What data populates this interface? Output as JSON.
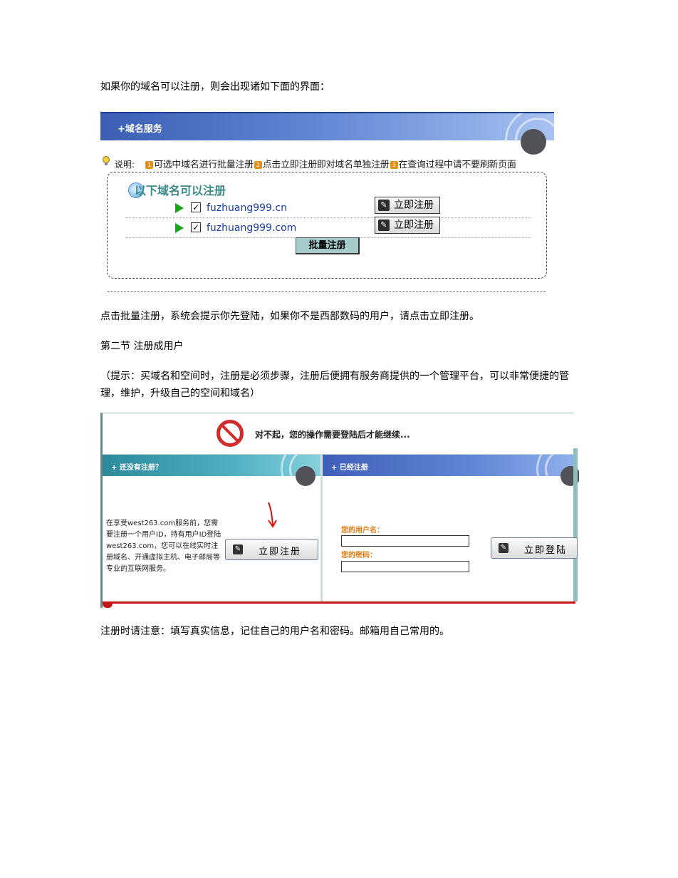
{
  "paragraphs": {
    "p1": "如果你的域名可以注册，则会出现诸如下面的界面：",
    "p2": "点击批量注册，系统会提示你先登陆，如果你不是西部数码的用户，请点击立即注册。",
    "p3": "第二节  注册成用户",
    "p4": "（提示：买域名和空间时，注册是必须步骤，注册后便拥有服务商提供的一个管理平台，可以非常便捷的管理，维护，升级自己的空间和域名）",
    "p5": "注册时请注意：填写真实信息，记住自己的用户名和密码。邮箱用自己常用的。"
  },
  "domain_panel": {
    "header": "+域名服务",
    "note_label": "说明:",
    "note_items": [
      "可选中域名进行批量注册",
      "点击立即注册即对域名单独注册",
      "在查询过程中请不要刷新页面"
    ],
    "note_numbers": [
      "1",
      "2",
      "3"
    ],
    "available_title": "以下域名可以注册",
    "domains": [
      {
        "name": "fuzhuang999.cn",
        "checked_mark": "✓",
        "button": "立即注册"
      },
      {
        "name": "fuzhuang999.com",
        "checked_mark": "✓",
        "button": "立即注册"
      }
    ],
    "batch_button": "批量注册"
  },
  "login_panel": {
    "notice": "对不起，您的操作需要登陆后才能继续...",
    "left_title": "+ 还没有注册？",
    "right_title": "+ 已经注册",
    "intro": "在享受west263.com服务前，您需要注册一个用户ID，持有用户ID登陆west263.com，您可以在线实时注册域名、开通虚拟主机、电子邮局等专业的互联网服务。",
    "register_button": "立即注册",
    "username_label": "您的用户名：",
    "password_label": "您的密码：",
    "login_button": "立即登陆"
  },
  "colors": {
    "header_blue": "#3c5fb4",
    "header_teal": "#2c8a9c",
    "domain_link": "#1b3ea3",
    "warning_red": "#d12b2b",
    "label_orange": "#e07a10",
    "arrow_red": "#e01010"
  }
}
